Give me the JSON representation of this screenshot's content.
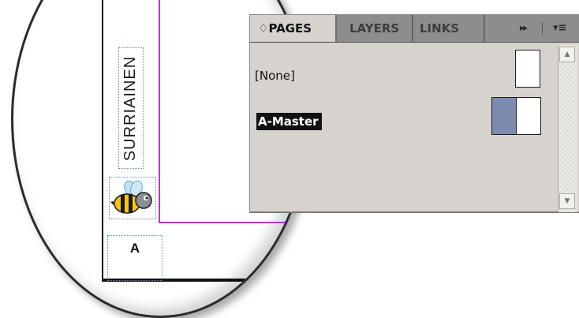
{
  "document": {
    "vertical_text": "SURRIAINEN",
    "page_letter": "A",
    "margin_guide_color": "#b23bc6",
    "logo_icon": "bee-icon"
  },
  "panel": {
    "tabs": [
      {
        "label": "♢PAGES",
        "active": true
      },
      {
        "label": "LAYERS",
        "active": false
      },
      {
        "label": "LINKS",
        "active": false
      }
    ],
    "controls": {
      "expand_icon": "▸▸",
      "menu_icon": "▾≡"
    },
    "items": [
      {
        "label": "[None]",
        "selected": false
      },
      {
        "label": "A-Master",
        "selected": true
      }
    ],
    "colors": {
      "panel_bg": "#d6d3ce",
      "tabbar_bg": "#6e6e6e",
      "master_left_page": "#7e89b0"
    }
  },
  "scrollbar": {
    "up_icon": "▲",
    "down_icon": "▼"
  }
}
